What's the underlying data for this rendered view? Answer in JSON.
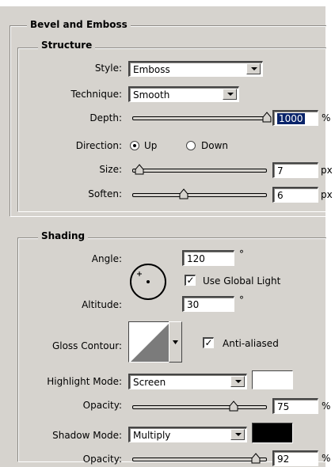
{
  "colors": {
    "panel": "#d6d3ce",
    "highlight_selection": "#0a246a",
    "shadow_swatch": "#000000",
    "highlight_swatch": "#ffffff"
  },
  "bevel_group": {
    "title": "Bevel and Emboss",
    "structure": {
      "title": "Structure",
      "style": {
        "label": "Style:",
        "value": "Emboss"
      },
      "technique": {
        "label": "Technique:",
        "value": "Smooth"
      },
      "depth": {
        "label": "Depth:",
        "value": "1000",
        "unit": "%",
        "slider_fraction": 1.0
      },
      "direction": {
        "label": "Direction:",
        "up_label": "Up",
        "down_label": "Down",
        "selected": "Up"
      },
      "size": {
        "label": "Size:",
        "value": "7",
        "unit": "px",
        "slider_fraction": 0.05
      },
      "soften": {
        "label": "Soften:",
        "value": "6",
        "unit": "px",
        "slider_fraction": 0.38
      }
    }
  },
  "shading": {
    "title": "Shading",
    "angle": {
      "label": "Angle:",
      "value": "120",
      "unit": "°"
    },
    "use_global_light": {
      "label": "Use Global Light",
      "checked": true
    },
    "altitude": {
      "label": "Altitude:",
      "value": "30",
      "unit": "°"
    },
    "gloss_contour": {
      "label": "Gloss Contour:"
    },
    "anti_aliased": {
      "label": "Anti-aliased",
      "checked": true
    },
    "highlight_mode": {
      "label": "Highlight Mode:",
      "value": "Screen"
    },
    "highlight_opacity": {
      "label": "Opacity:",
      "value": "75",
      "unit": "%",
      "slider_fraction": 0.75
    },
    "shadow_mode": {
      "label": "Shadow Mode:",
      "value": "Multiply"
    },
    "shadow_opacity": {
      "label": "Opacity:",
      "value": "92",
      "unit": "%",
      "slider_fraction": 0.92
    }
  }
}
